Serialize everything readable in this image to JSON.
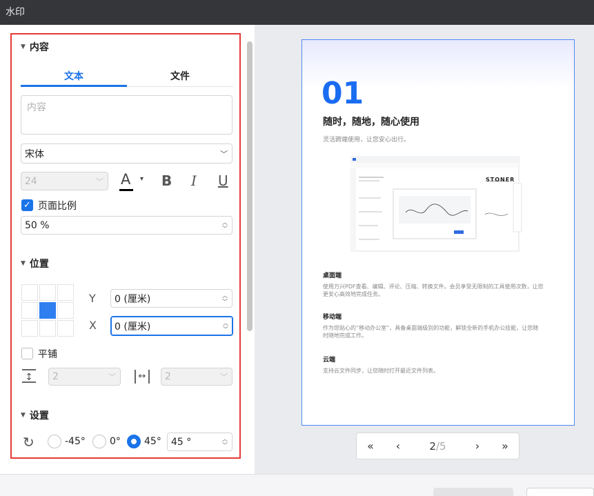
{
  "window": {
    "title": "水印"
  },
  "content_section": {
    "heading": "内容",
    "tabs": [
      {
        "label": "文本",
        "active": true
      },
      {
        "label": "文件",
        "active": false
      }
    ],
    "text_placeholder": "内容",
    "font": "宋体",
    "font_size": "24",
    "page_scale": {
      "label": "页面比例",
      "checked": true,
      "value": "50 %"
    }
  },
  "position_section": {
    "heading": "位置",
    "selected_cell": "middle-center",
    "y_label": "Y",
    "y_value": "0 (厘米)",
    "x_label": "X",
    "x_value": "0 (厘米)",
    "tile": {
      "label": "平铺",
      "checked": false
    },
    "tile_vertical_spacing": "2",
    "tile_horizontal_spacing": "2"
  },
  "settings_section": {
    "heading": "设置",
    "rotation_options": [
      "-45°",
      "0°",
      "45°"
    ],
    "rotation_selected": "45°",
    "rotation_value": "45 °"
  },
  "preview": {
    "number": "01",
    "headline": "随时，随地，随心使用",
    "subline": "灵活跨端使用，让您安心出行。",
    "mock_logo": "STONER",
    "blocks": [
      {
        "title": "桌面端",
        "text": "使用万兴PDF查看、编辑、评论、压缩、转换文件。会员享受无限制的工具使用次数，让您更安心高效地完成任务。"
      },
      {
        "title": "移动端",
        "text": "作为您贴心的“移动办公室”，具备桌面端级别的功能，解锁全新的手机办公技能，让您随时随地完成工作。"
      },
      {
        "title": "云端",
        "text": "支持云文件同步，让您随时打开最近文件列表。"
      }
    ]
  },
  "pager": {
    "first": "«",
    "prev": "‹",
    "current": "2",
    "total": "/5",
    "next": "›",
    "last": "»"
  },
  "colors": {
    "accent": "#1a73e8",
    "highlight_frame": "#e53935",
    "titlebar": "#35363a"
  }
}
